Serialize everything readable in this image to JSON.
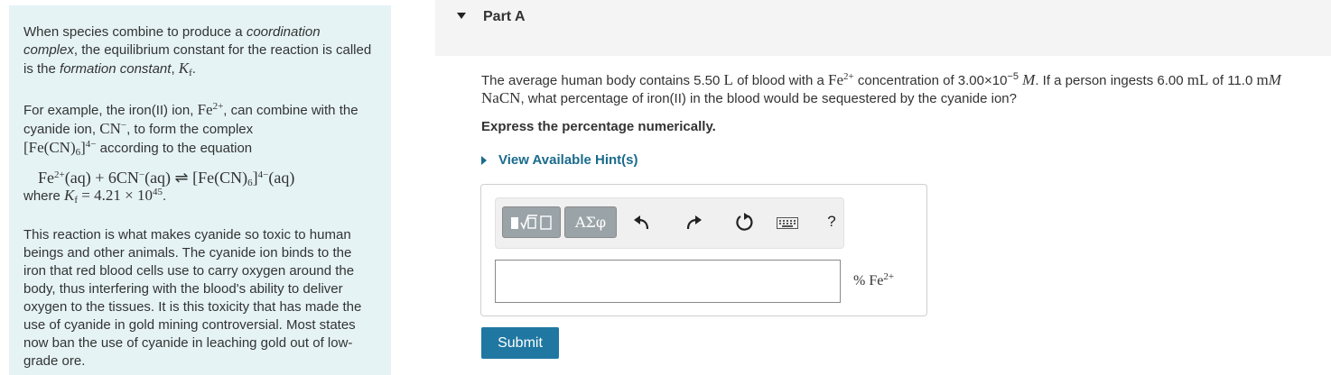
{
  "intro": {
    "p1_a": "When species combine to produce a ",
    "p1_em1": "coordination complex",
    "p1_b": ", the equilibrium constant for the reaction is called is the ",
    "p1_em2": "formation constant",
    "p1_c": ", ",
    "kf_symbol": "K",
    "kf_sub": "f",
    "p1_end": ".",
    "p2_a": "For example, the iron(II) ion, ",
    "fe": "Fe",
    "fe_charge": "2+",
    "p2_b": ", can combine with the cyanide ion, ",
    "cn": "CN",
    "cn_charge": "−",
    "p2_c": ", to form the complex ",
    "complex_a": "[Fe(CN)",
    "complex_sub": "6",
    "complex_b": "]",
    "complex_charge": "4−",
    "p2_d": " according to the equation",
    "eq_fe": "Fe",
    "eq_fe_charge": "2+",
    "eq_part1": "(aq) + 6CN",
    "eq_cn_charge": "−",
    "eq_part2": "(aq) ⇌ [Fe(CN)",
    "eq_sub": "6",
    "eq_part3": "]",
    "eq_complex_charge": "4−",
    "eq_part4": "(aq)",
    "where": "where ",
    "kf_value_eq": " = 4.21 × 10",
    "kf_exp": "45",
    "where_end": ".",
    "p3": "This reaction is what makes cyanide so toxic to human beings and other animals. The cyanide ion binds to the iron that red blood cells use to carry oxygen around the body, thus interfering with the blood's ability to deliver oxygen to the tissues. It is this toxicity that has made the use of cyanide in gold mining controversial. Most states now ban the use of cyanide in leaching gold out of low-grade ore."
  },
  "part": {
    "title": "Part A"
  },
  "question": {
    "a": "The average human body contains 5.50 ",
    "l_unit": "L",
    "b": " of blood with a ",
    "fe": "Fe",
    "fe_charge": "2+",
    "c": " concentration of 3.00×10",
    "exp": "−5",
    "d": " ",
    "m_unit": "M",
    "e": ". If a person ingests 6.00 ",
    "ml_unit": "mL",
    "f": " of 11.0 ",
    "mm_unit": "m",
    "mm_unit_it": "M",
    "g": " ",
    "nacn": "NaCN",
    "h": ", what percentage of iron(II) in the blood would be sequestered by the cyanide ion?"
  },
  "instruction": "Express the percentage numerically.",
  "hint_label": "View Available Hint(s)",
  "toolbar": {
    "symbols_label": "ΑΣφ",
    "help_label": "?"
  },
  "answer": {
    "value": "",
    "unit_a": "% Fe",
    "unit_charge": "2+"
  },
  "submit_label": "Submit",
  "colors": {
    "panel_bg": "#e5f3f5",
    "link": "#1a6b8c",
    "submit": "#1f77a2"
  },
  "icons": [
    "templates-icon",
    "undo-icon",
    "redo-icon",
    "reset-icon",
    "keyboard-icon",
    "help-icon",
    "disclosure-triangle-icon"
  ]
}
